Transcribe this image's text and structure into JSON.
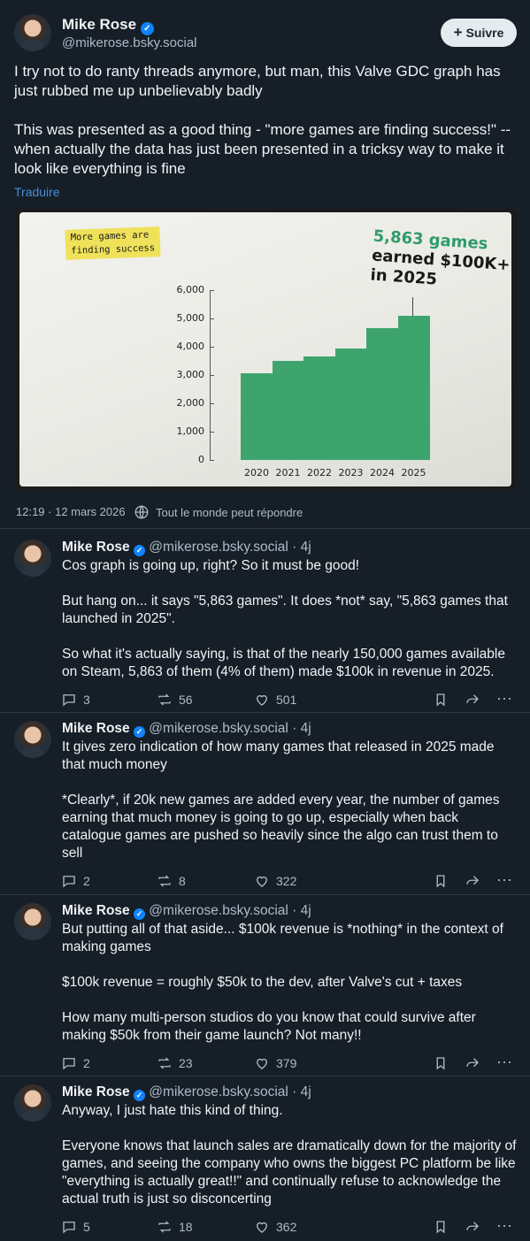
{
  "main_post": {
    "author_name": "Mike Rose",
    "author_handle": "@mikerose.bsky.social",
    "follow_label": "Suivre",
    "text": "I try not to do ranty threads anymore, but man, this Valve GDC graph has just rubbed me up unbelievably badly\n\nThis was presented as a good thing - \"more games are finding success!\" -- when actually the data has just been presented in a tricksy way to make it look like everything is fine",
    "translate_label": "Traduire",
    "timestamp": "12:19 · 12 mars 2026",
    "reply_setting": "Tout le monde peut répondre"
  },
  "chart_data": {
    "type": "bar",
    "tag": "More games are\nfinding success",
    "callout_games": "5,863 games",
    "callout_rest": "earned $100K+\nin 2025",
    "categories": [
      "2020",
      "2021",
      "2022",
      "2023",
      "2024",
      "2025"
    ],
    "values": [
      3050,
      3500,
      3650,
      3950,
      4650,
      5100
    ],
    "yticks": [
      "0",
      "1,000",
      "2,000",
      "3,000",
      "4,000",
      "5,000",
      "6,000"
    ],
    "ylim": [
      0,
      6000
    ],
    "bar_color": "#3ea46d"
  },
  "replies": [
    {
      "author_name": "Mike Rose",
      "author_handle": "@mikerose.bsky.social · 4j",
      "text": "Cos graph is going up, right? So it must be good!\n\nBut hang on... it says \"5,863 games\". It does *not* say, \"5,863 games that launched in 2025\".\n\nSo what it's actually saying, is that of the nearly 150,000 games available on Steam, 5,863 of them (4% of them) made $100k in revenue in 2025.",
      "replies": "3",
      "reposts": "56",
      "likes": "501"
    },
    {
      "author_name": "Mike Rose",
      "author_handle": "@mikerose.bsky.social · 4j",
      "text": "It gives zero indication of how many games that released in 2025 made that much money\n\n*Clearly*, if 20k new games are added every year, the number of games earning that much money is going to go up, especially when back catalogue games are pushed so heavily since the algo can trust them to sell",
      "replies": "2",
      "reposts": "8",
      "likes": "322"
    },
    {
      "author_name": "Mike Rose",
      "author_handle": "@mikerose.bsky.social · 4j",
      "text": "But putting all of that aside... $100k revenue is *nothing* in the context of making games\n\n$100k revenue = roughly $50k to the dev, after Valve's cut + taxes\n\nHow many multi-person studios do you know that could survive after making $50k from their game launch? Not many!!",
      "replies": "2",
      "reposts": "23",
      "likes": "379"
    },
    {
      "author_name": "Mike Rose",
      "author_handle": "@mikerose.bsky.social · 4j",
      "text": "Anyway, I just hate this kind of thing.\n\nEveryone knows that launch sales are dramatically down for the majority of games, and seeing the company who owns the biggest PC platform be like \"everything is actually great!!\" and continually refuse to acknowledge the actual truth is just so disconcerting",
      "replies": "5",
      "reposts": "18",
      "likes": "362"
    }
  ]
}
